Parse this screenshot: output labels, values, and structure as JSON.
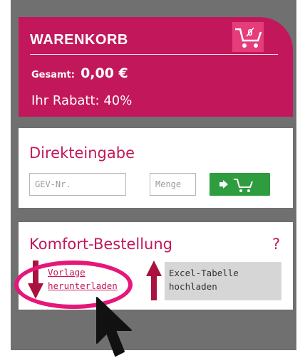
{
  "cart": {
    "title": "WARENKORB",
    "total_label": "Gesamt:",
    "total_value": "0,00 €",
    "discount": "Ihr Rabatt: 40%",
    "icon": "cart-percent-icon"
  },
  "direct_entry": {
    "title": "Direkteingabe",
    "gev_placeholder": "GEV-Nr.",
    "qty_placeholder": "Menge",
    "add_button_icon": "add-to-cart-icon"
  },
  "comfort_order": {
    "title": "Komfort-Bestellung",
    "help": "?",
    "download_link_line1": "Vorlage",
    "download_link_line2": "herunterladen",
    "upload_line1": "Excel-Tabelle",
    "upload_line2": "hochladen"
  },
  "colors": {
    "brand": "#c2185b",
    "panel": "#707070",
    "button_green": "#2e9d3f",
    "highlight": "#e5177a"
  }
}
